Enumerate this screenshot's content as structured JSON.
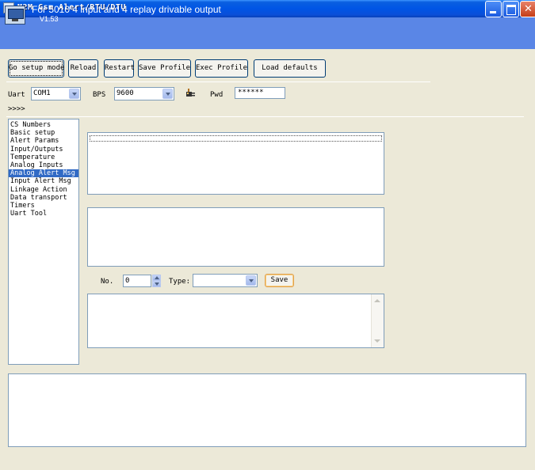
{
  "window": {
    "title": "M2M Gsm Alert/RTU/DTU"
  },
  "header": {
    "title": "For 5010 4 input and 4 replay drivable output",
    "version": "V1.53"
  },
  "toolbar": {
    "go_setup_mode": "Go setup mode",
    "reload": "Reload",
    "restart": "Restart",
    "save_profile": "Save Profile",
    "exec_profile": "Exec Profile",
    "load_defaults": "Load defaults"
  },
  "connection": {
    "uart_label": "Uart",
    "uart_value": "COM1",
    "bps_label": "BPS",
    "bps_value": "9600",
    "pwd_label": "Pwd",
    "pwd_value": "******",
    "connect_icon": "plug-connect-icon"
  },
  "indicator": ">>>>",
  "menu": {
    "items": [
      "CS Numbers",
      "Basic setup",
      "Alert Params",
      "Input/Outputs",
      "Temperature",
      "Analog Inputs",
      "Analog Alert Msg",
      "Input Alert Msg",
      "Linkage Action",
      "Data transport",
      "Timers",
      "Uart Tool"
    ],
    "selected": "Analog Alert Msg"
  },
  "editor": {
    "no_label": "No.",
    "no_value": "0",
    "type_label": "Type:",
    "type_value": "",
    "save_label": "Save"
  },
  "colors": {
    "title_bar": "#0055e5",
    "header_band": "#5a86e6",
    "selection": "#316ac5",
    "background": "#ece9d8"
  }
}
